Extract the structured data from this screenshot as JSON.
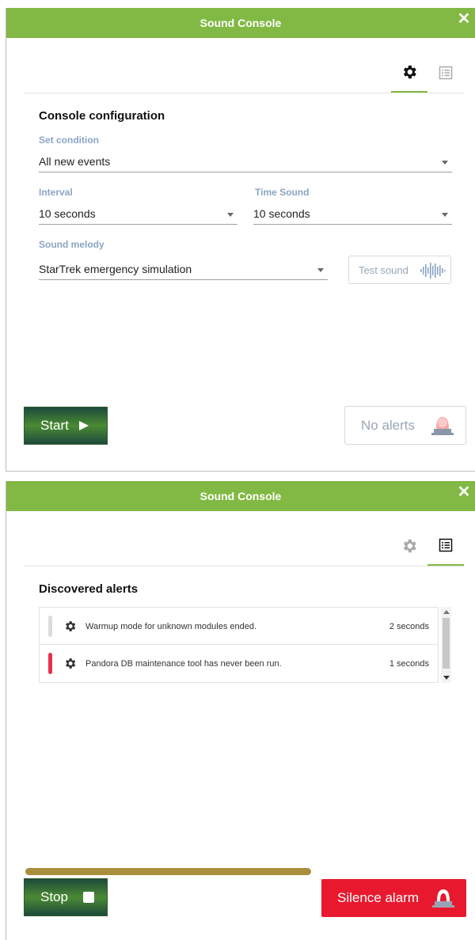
{
  "colors": {
    "titlebar": "#82b944",
    "label": "#8aa5c3",
    "danger": "#e8192e",
    "progress": "#a98e3e",
    "flag_inactive": "#dcdcdc",
    "flag_critical": "#e8304f"
  },
  "panel1": {
    "title": "Sound Console",
    "tabs": [
      {
        "icon": "gear-icon",
        "active": true
      },
      {
        "icon": "list-icon",
        "active": false
      }
    ],
    "section_title": "Console configuration",
    "set_condition": {
      "label": "Set condition",
      "value": "All new events"
    },
    "interval": {
      "label": "Interval",
      "value": "10 seconds"
    },
    "time_sound": {
      "label": "Time Sound",
      "value": "10 seconds"
    },
    "sound_melody": {
      "label": "Sound melody",
      "value": "StarTrek emergency simulation"
    },
    "test_sound_label": "Test sound",
    "start_label": "Start",
    "no_alerts_label": "No alerts"
  },
  "panel2": {
    "title": "Sound Console",
    "tabs": [
      {
        "icon": "gear-icon",
        "active": false
      },
      {
        "icon": "list-icon",
        "active": true
      }
    ],
    "section_title": "Discovered alerts",
    "alerts": [
      {
        "message": "Warmup mode for unknown modules ended.",
        "time": "2 seconds",
        "severity": "inactive"
      },
      {
        "message": "Pandora DB maintenance tool has never been run.",
        "time": "1 seconds",
        "severity": "critical"
      }
    ],
    "progress_fraction": 0.97,
    "stop_label": "Stop",
    "silence_label": "Silence alarm"
  }
}
